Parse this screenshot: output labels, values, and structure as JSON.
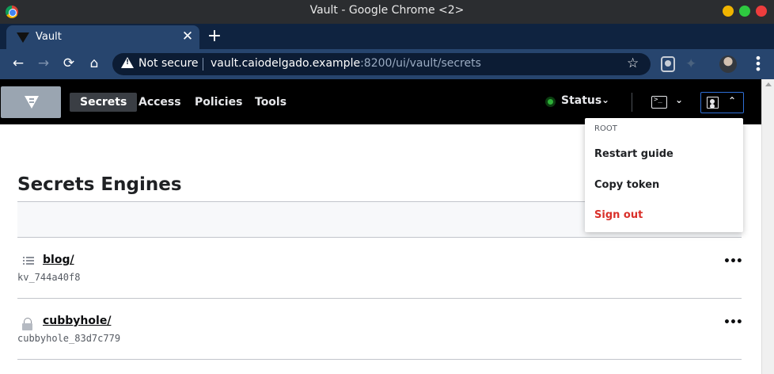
{
  "window": {
    "title": "Vault - Google Chrome <2>"
  },
  "tab": {
    "title": "Vault",
    "close": "✕",
    "new_tab": "+"
  },
  "toolbar": {
    "back": "←",
    "forward": "→",
    "reload": "⟳",
    "home": "⌂",
    "security_label": "Not secure",
    "url_host": "vault.caiodelgado.example",
    "url_rest": ":8200/ui/vault/secrets",
    "star": "☆",
    "menu": "⋮"
  },
  "vault_nav": {
    "links": [
      "Secrets",
      "Access",
      "Policies",
      "Tools"
    ],
    "status_label": "Status",
    "chevron_down": "⌄",
    "chevron_up": "⌃"
  },
  "main": {
    "title": "Secrets Engines",
    "engines": [
      {
        "path": "blog/",
        "accessor": "kv_744a40f8",
        "icon": "list-icon"
      },
      {
        "path": "cubbyhole/",
        "accessor": "cubbyhole_83d7c779",
        "icon": "lock-icon"
      }
    ],
    "more": "•••"
  },
  "user_menu": {
    "header": "ROOT",
    "items": [
      "Restart guide",
      "Copy token",
      "Sign out"
    ]
  },
  "colors": {
    "tab_bg": "#27456e",
    "nav_bg": "#000000",
    "status_ok": "#2eb039",
    "danger": "#d9302a",
    "focus": "#2f6fd6"
  }
}
